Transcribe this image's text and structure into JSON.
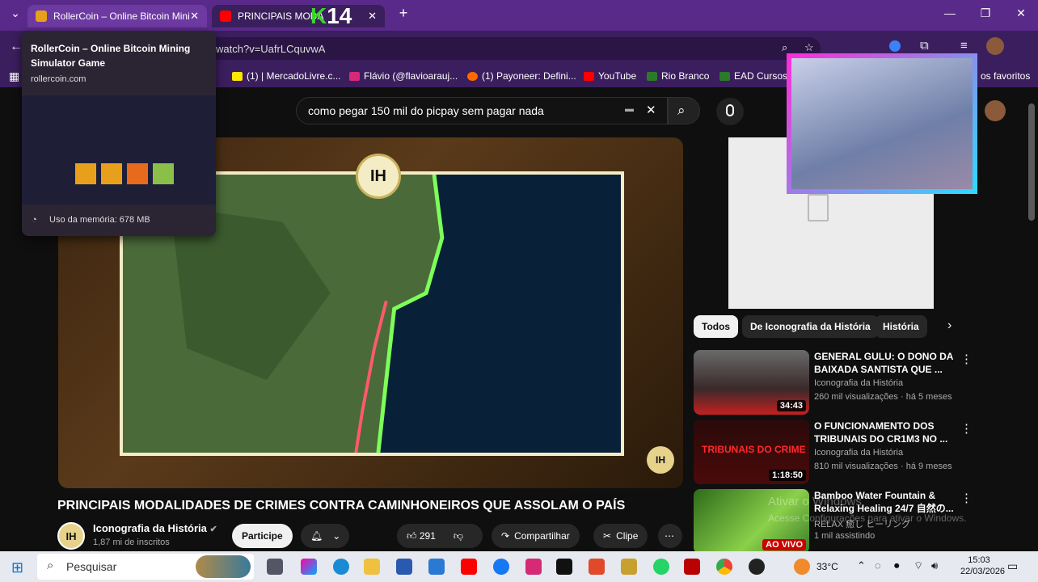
{
  "tabs": [
    {
      "title": "RollerCoin – Online Bitcoin Mini",
      "icon": "rollercoin-favicon"
    },
    {
      "title": "PRINCIPAIS MODA",
      "icon": "youtube-favicon"
    }
  ],
  "new_tab_label": "+",
  "stream_overlay": "14",
  "omnibox": {
    "url": "watch?v=UafrLCquvwA"
  },
  "bookmarks": [
    {
      "label": "(1) | MercadoLivre.c..."
    },
    {
      "label": "Flávio (@flavioarauj..."
    },
    {
      "label": "(1) Payoneer: Defini..."
    },
    {
      "label": "YouTube"
    },
    {
      "label": "Rio Branco"
    },
    {
      "label": "EAD Cursos"
    },
    {
      "label": "os favoritos"
    }
  ],
  "hovercard": {
    "title": "RollerCoin – Online Bitcoin Mining Simulator Game",
    "domain": "rollercoin.com",
    "memory": "Uso da memória: 678 MB"
  },
  "search": {
    "query": "como pegar 150 mil do picpay sem pagar nada"
  },
  "video": {
    "title": "PRINCIPAIS MODALIDADES DE CRIMES CONTRA CAMINHONEIROS QUE ASSOLAM O PAÍS",
    "channel": "Iconografia da História",
    "subscribers": "1,87 mi de inscritos",
    "join_label": "Participe",
    "likes": "291",
    "share_label": "Compartilhar",
    "clip_label": "Clipe",
    "logo_text": "IH"
  },
  "chips": [
    "Todos",
    "De Iconografia da História",
    "História"
  ],
  "recommendations": [
    {
      "title": "GENERAL GULU: O DONO DA BAIXADA SANTISTA QUE ...",
      "channel": "Iconografia da História",
      "meta": "260 mil visualizações · há 5 meses",
      "duration": "34:43"
    },
    {
      "title": "O FUNCIONAMENTO DOS TRIBUNAIS DO CR1M3 NO ...",
      "channel": "Iconografia da História",
      "meta": "810 mil visualizações · há 9 meses",
      "duration": "1:18:50",
      "thumb_text": "TRIBUNAIS DO CRIME"
    },
    {
      "title": "Bamboo Water Fountain & Relaxing Healing 24/7 自然の...",
      "channel": "RELAX 癒し ヒーリング",
      "meta": "1 mil assistindo",
      "duration": "AO VIVO"
    }
  ],
  "watermark": {
    "line1": "Ativar o Windows",
    "line2": "Acesse Configurações para ativar o Windows."
  },
  "taskbar": {
    "search_placeholder": "Pesquisar",
    "temperature": "33°C",
    "time": "15:03",
    "date": "22/03/2026"
  }
}
